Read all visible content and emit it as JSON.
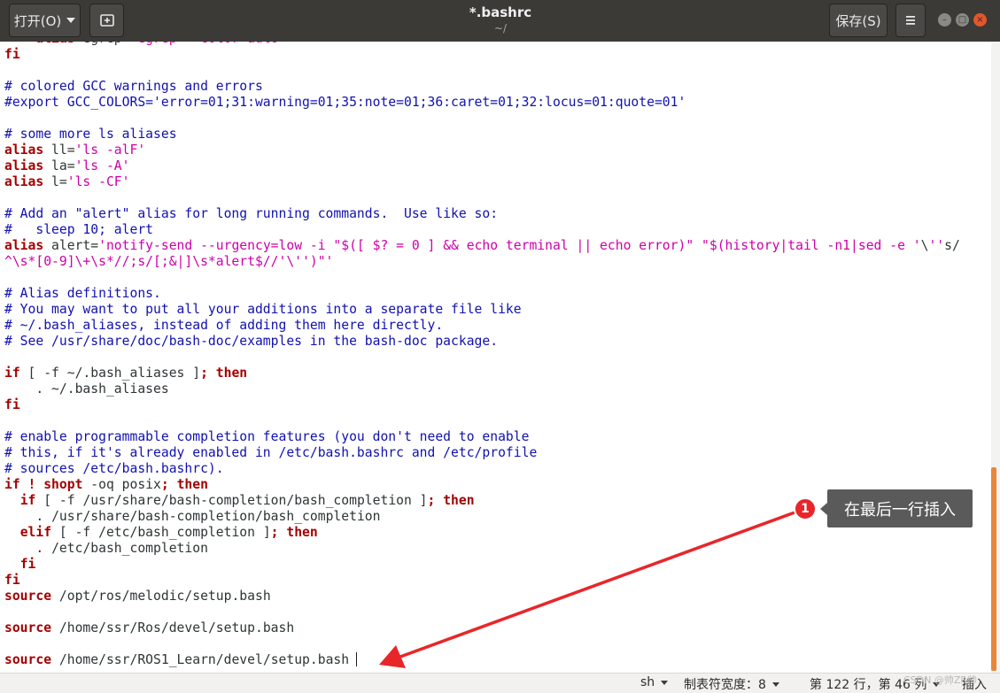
{
  "header": {
    "open_label": "打开(O)",
    "save_label": "保存(S)",
    "title": "*.bashrc",
    "subtitle": "~/",
    "window_min": "–",
    "window_max": "□",
    "window_close": "×"
  },
  "editor": {
    "lines": [
      "    alias egrep='egrep --color=auto'",
      "fi",
      "",
      "# colored GCC warnings and errors",
      "#export GCC_COLORS='error=01;31:warning=01;35:note=01;36:caret=01;32:locus=01:quote=01'",
      "",
      "# some more ls aliases",
      "alias ll='ls -alF'",
      "alias la='ls -A'",
      "alias l='ls -CF'",
      "",
      "# Add an \"alert\" alias for long running commands.  Use like so:",
      "#   sleep 10; alert",
      "alias alert='notify-send --urgency=low -i \"$([ $? = 0 ] && echo terminal || echo error)\" \"$(history|tail -n1|sed -e '\\''s/",
      "^\\s*[0-9]\\+\\s*//;s/[;&|]\\s*alert$//'\\'')\"'",
      "",
      "# Alias definitions.",
      "# You may want to put all your additions into a separate file like",
      "# ~/.bash_aliases, instead of adding them here directly.",
      "# See /usr/share/doc/bash-doc/examples in the bash-doc package.",
      "",
      "if [ -f ~/.bash_aliases ]; then",
      "    . ~/.bash_aliases",
      "fi",
      "",
      "# enable programmable completion features (you don't need to enable",
      "# this, if it's already enabled in /etc/bash.bashrc and /etc/profile",
      "# sources /etc/bash.bashrc).",
      "if ! shopt -oq posix; then",
      "  if [ -f /usr/share/bash-completion/bash_completion ]; then",
      "    . /usr/share/bash-completion/bash_completion",
      "  elif [ -f /etc/bash_completion ]; then",
      "    . /etc/bash_completion",
      "  fi",
      "fi",
      "source /opt/ros/melodic/setup.bash",
      "",
      "source /home/ssr/Ros/devel/setup.bash",
      "",
      "source /home/ssr/ROS1_Learn/devel/setup.bash"
    ]
  },
  "statusbar": {
    "language": "sh",
    "tab_width": "制表符宽度：8",
    "position": "第 122 行，第 46 列",
    "mode": "插入"
  },
  "annotation": {
    "badge_number": "1",
    "callout_text": "在最后一行插入",
    "arrow_color": "#e8262a"
  },
  "watermark": "CSDN @帅ZR帅",
  "colors": {
    "headerbar": "#3b3a36",
    "comment": "#1111b0",
    "keyword": "#a40000",
    "string": "#cc00a8",
    "scroll_thumb": "#e8873a"
  }
}
